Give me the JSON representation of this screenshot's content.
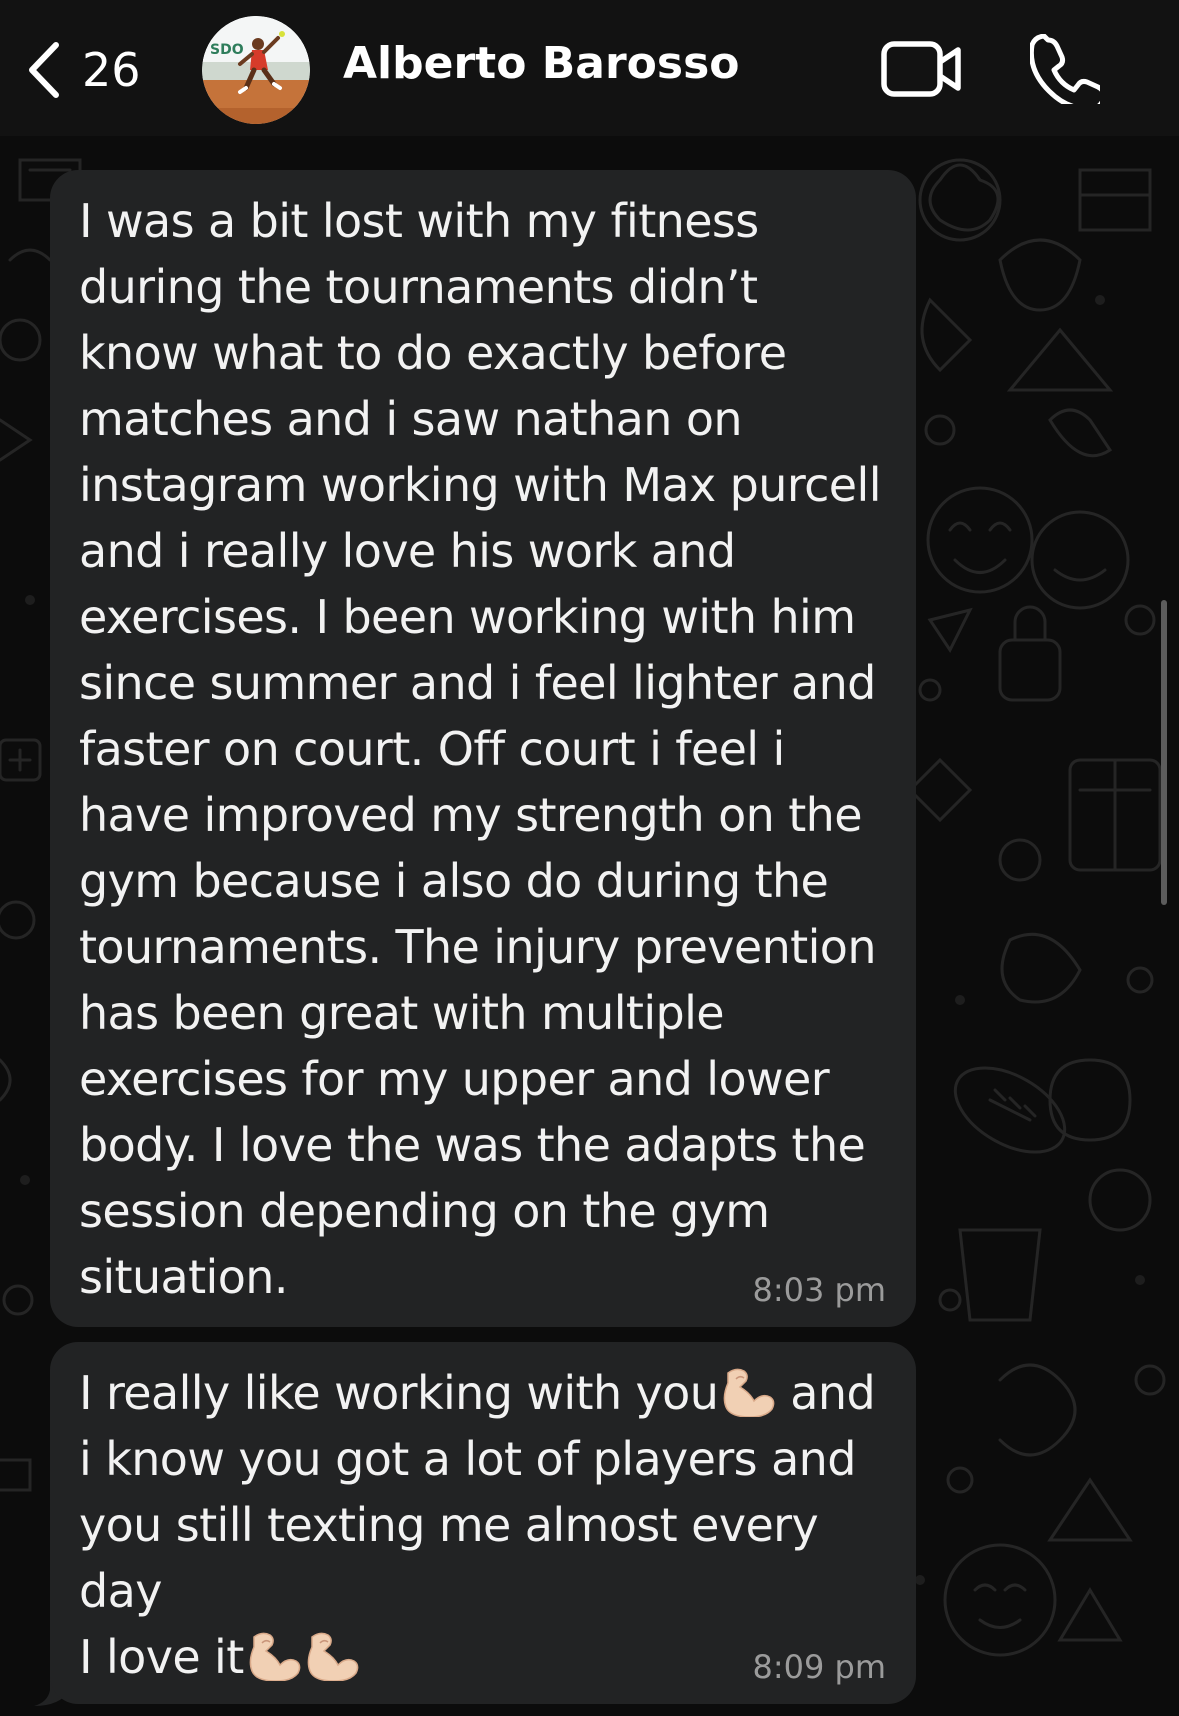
{
  "header": {
    "back_count": "26",
    "contact_name": "Alberto Barosso",
    "avatar_logo_text": "SDO"
  },
  "messages": [
    {
      "text": "I was a bit lost with my fitness\nduring the tournaments didn’t\nknow what to do exactly before\nmatches and i saw nathan on\ninstagram working with Max purcell\nand i really love his work and\nexercises. I been working with him\nsince summer and i feel lighter and\nfaster on court. Off court i feel i\nhave improved my strength on the\ngym because i also do during the\ntournaments. The injury prevention\nhas been great with multiple\nexercises for my upper and lower\nbody. I love the was the adapts the\nsession depending on the gym\nsituation.",
      "time": "8:03 pm"
    },
    {
      "line1_before_emoji": "I really like working with you",
      "line1_after_emoji": " and",
      "body": "i know you got a lot of players and\nyou still texting me almost every\nday",
      "last_line": "I love it",
      "emoji": "flexed-biceps",
      "time": "8:09 pm"
    }
  ],
  "colors": {
    "background": "#0c0c0c",
    "header": "#121212",
    "bubble": "#222324",
    "text": "#f2f2f2",
    "timestamp": "#9b9b9b"
  },
  "icons": {
    "back": "chevron-left-icon",
    "video": "video-camera-icon",
    "phone": "phone-icon"
  }
}
